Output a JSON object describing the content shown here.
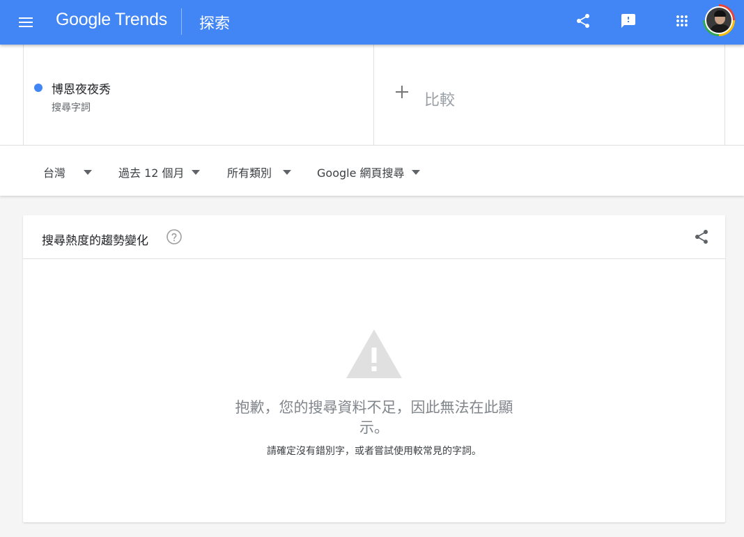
{
  "header": {
    "logo_google": "Google",
    "logo_trends": "Trends",
    "page_title": "探索",
    "icons": [
      "menu-icon",
      "share-icon",
      "feedback-icon",
      "apps-icon"
    ],
    "accent_color": "#4285f4"
  },
  "comparison": {
    "term": {
      "name": "博恩夜夜秀",
      "type": "搜尋字詞",
      "color": "#4285f4"
    },
    "add_label": "比較"
  },
  "filters": {
    "region": "台灣",
    "time_range": "過去 12 個月",
    "category": "所有類別",
    "property": "Google 網頁搜尋"
  },
  "interest_card": {
    "title": "搜尋熱度的趨勢變化",
    "error_message": "抱歉，您的搜尋資料不足，因此無法在此顯示。",
    "error_hint": "請確定沒有錯別字，或者嘗試使用較常見的字詞。"
  }
}
